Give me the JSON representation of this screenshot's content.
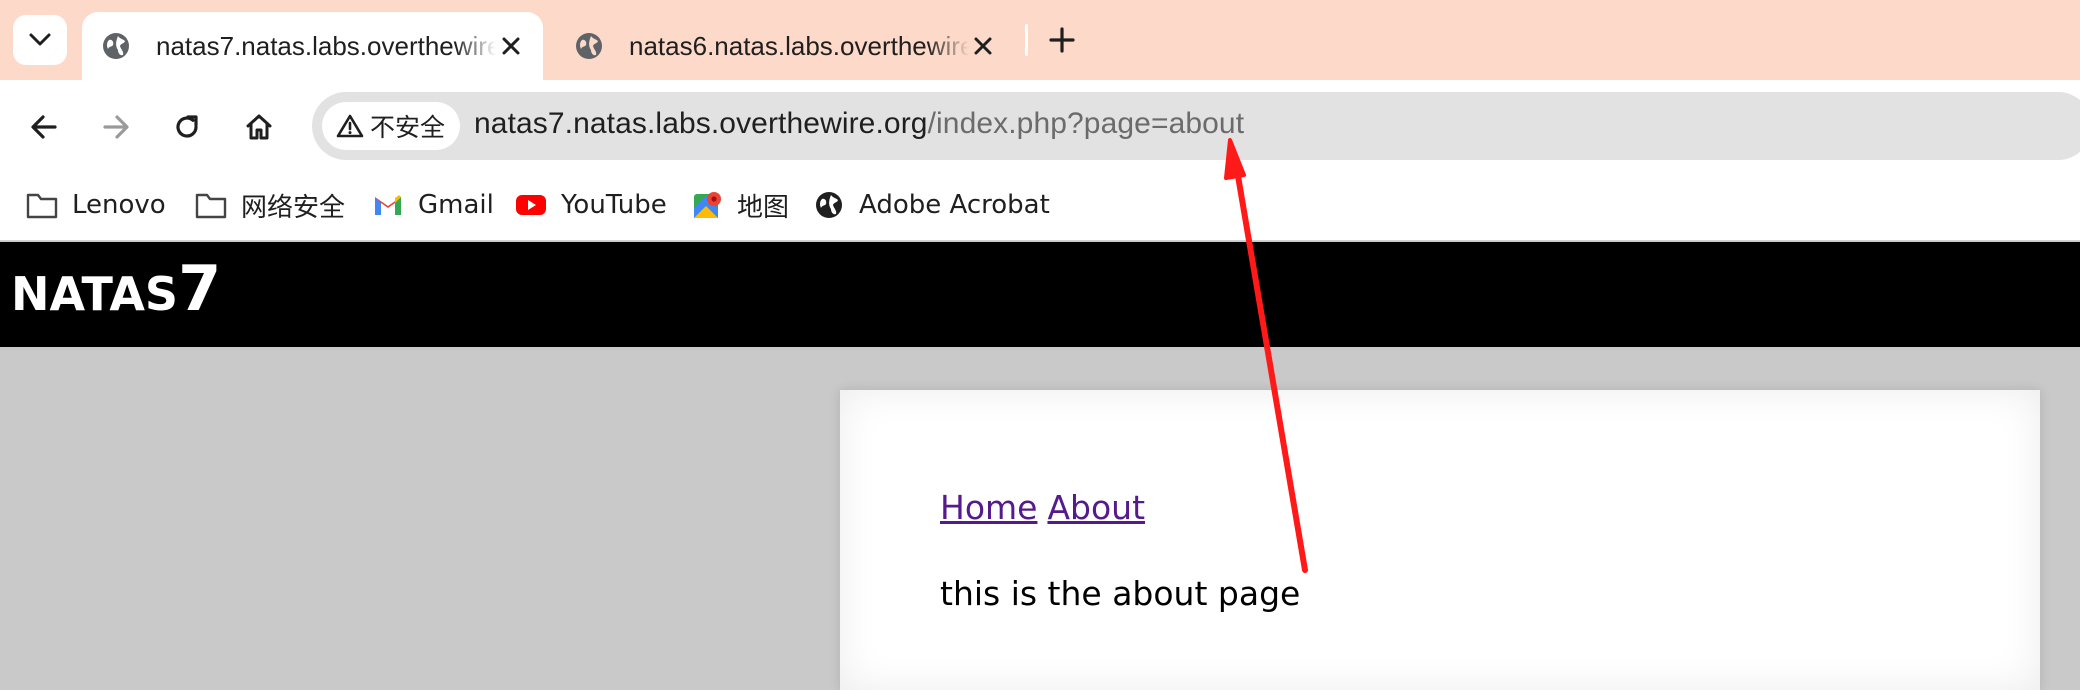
{
  "browser": {
    "tabs": [
      {
        "title": "natas7.natas.labs.overthewire.org",
        "active": true
      },
      {
        "title": "natas6.natas.labs.overthewire.org",
        "active": false
      }
    ],
    "omnibox": {
      "security_label": "不安全",
      "url_host": "natas7.natas.labs.overthewire.org",
      "url_path": "/index.php?page=about"
    },
    "bookmarks": [
      {
        "label": "Lenovo",
        "icon": "folder-icon"
      },
      {
        "label": "网络安全",
        "icon": "folder-icon"
      },
      {
        "label": "Gmail",
        "icon": "gmail-icon"
      },
      {
        "label": "YouTube",
        "icon": "youtube-icon"
      },
      {
        "label": "地图",
        "icon": "maps-icon"
      },
      {
        "label": "Adobe Acrobat",
        "icon": "globe-icon"
      }
    ]
  },
  "page": {
    "title_prefix": "NATAS",
    "title_number": "7",
    "nav": {
      "home": "Home",
      "about": "About"
    },
    "text": "this is the about page"
  },
  "colors": {
    "tabstrip": "#fcd9c9",
    "annotation_arrow": "#ff1a1a",
    "visited_link": "#551a8b"
  }
}
